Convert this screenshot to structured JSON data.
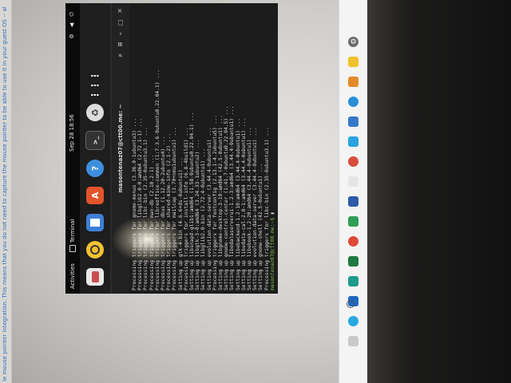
{
  "host": {
    "notice": "le mouse pointer integration. This means that you do not need to capture the mouse pointer to be able to use it in your guest OS -- all mouse actions you perform when the mouse"
  },
  "topbar": {
    "activities": "Activities",
    "app_name": "Terminal",
    "clock": "Sep 28  18:56",
    "tray": "⚙ ◀ ⏻"
  },
  "terminal": {
    "title": "masontenaz07@ctt00.me: ~",
    "lines": [
      "Processing triggers for gnome-menus (3.36.0-1ubuntu3) ...",
      "Processing triggers for libglib2.0-0:amd64 (2.72.1-1) ...",
      "Processing triggers for libc-bin (2.35-0ubuntu3.1) ...",
      "Processing triggers for man-db (2.10.2-1) ...",
      "Processing triggers for libreoffice-common (1:7.3.6-0ubuntu0.22.04.1) ...",
      "Processing triggers for dbus (1.12.20-2ubuntu4) ...",
      "Processing triggers for shared-mime-info (2.1-2) ...",
      "Processing triggers for mailcap (3.70+nmu1ubuntu1) ...",
      "Setting up gtk-4-bin (4.6.6+ds-0ubuntu1) ...",
      "Processing triggers for install-info (6.8-4build1) ...",
      "Setting up libsnapd-glib1:amd64 (1.58-0ubuntu0.22.04.1) ...",
      "Setting up libgtk-3-0:amd64 (3.24.33-1ubuntu2) ...",
      "Setting up libglib2.0-bin (2.72.4-0ubuntu1) ...",
      "Setting up evolution-data-server (3.44.4-0ubuntu1) ...",
      "Processing triggers for fontconfig (2.13.1-4.2ubuntu5) ...",
      "Setting up libgnome-desktop-3-19:amd64 (42.5-0ubuntu1) ...",
      "Setting up gnome-control-center (1:41.7-0ubuntu0.22.04.5) ...",
      "Setting up libedataserverui-1.2-3:amd64 (3.44.4-0ubuntu1) ...",
      "Setting up libebackend-1.2-10:amd64 (3.44.4-0ubuntu1) ...",
      "Setting up libedata-cal-2.0-1:amd64 (3.44.4-0ubuntu1) ...",
      "Setting up libebook-1.2-20:amd64 (3.44.4-0ubuntu1) ...",
      "Setting up evolution-data-server (3.44.4-0ubuntu1) ...",
      "Setting up gnome-shell (42.5-0ubuntu1) ...",
      "Processing triggers for libc-bin (2.35-0ubuntu3.1) ..."
    ],
    "prompt": "masontenaz07@ctt00.me:~$"
  }
}
